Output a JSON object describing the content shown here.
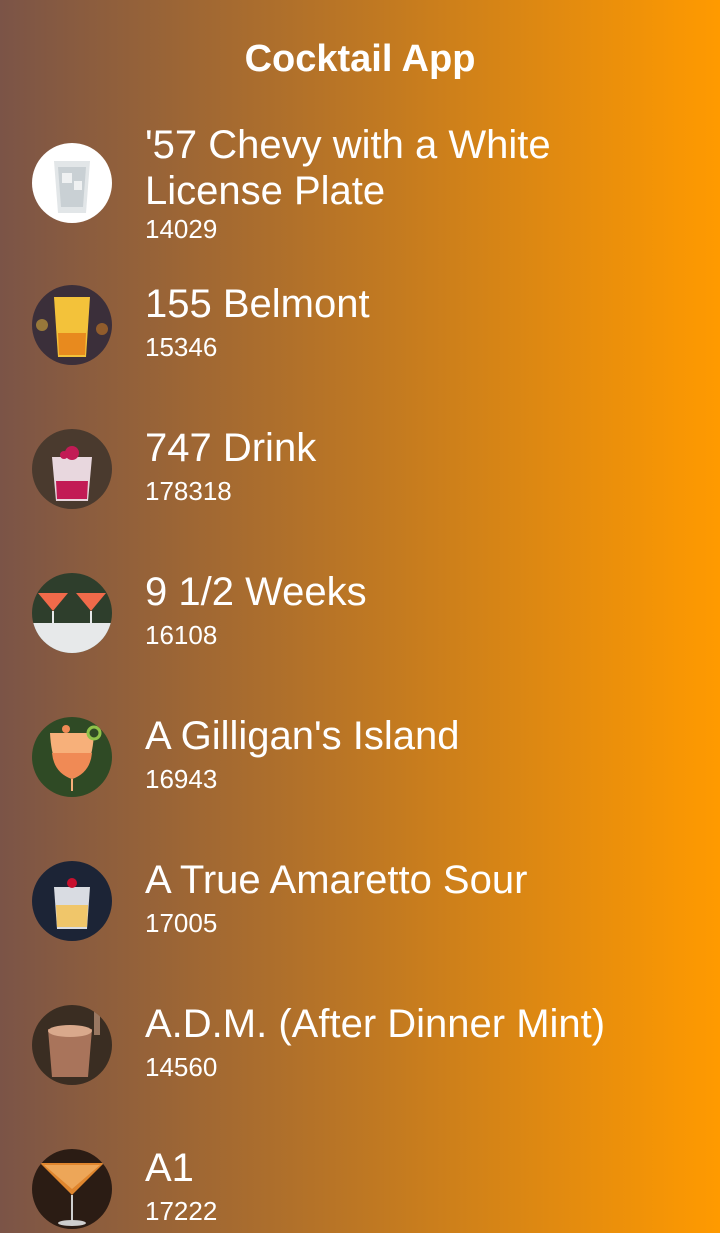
{
  "app": {
    "title": "Cocktail App",
    "background_gradient": {
      "from": "#7b5447",
      "to": "#ff9a00"
    }
  },
  "drinks": [
    {
      "name": "'57 Chevy with a White License Plate",
      "id": "14029",
      "thumb_icon": "ice-glass-photo",
      "colors": [
        "#ffffff",
        "#e2e6e8",
        "#b9c2c6"
      ]
    },
    {
      "name": "155 Belmont",
      "id": "15346",
      "thumb_icon": "yellow-cocktail-photo",
      "colors": [
        "#3b2f3a",
        "#f3c23a",
        "#e88a1e"
      ]
    },
    {
      "name": "747 Drink",
      "id": "178318",
      "thumb_icon": "pink-cocktail-photo",
      "colors": [
        "#4a3a2e",
        "#e8d7de",
        "#c21b55"
      ]
    },
    {
      "name": "9 1/2 Weeks",
      "id": "16108",
      "thumb_icon": "martini-glasses-photo",
      "colors": [
        "#2e3e2c",
        "#f06a4a",
        "#e7e9ea"
      ]
    },
    {
      "name": "A Gilligan's Island",
      "id": "16943",
      "thumb_icon": "orange-cocktail-photo",
      "colors": [
        "#2f4a25",
        "#f7b07a",
        "#f08a55"
      ]
    },
    {
      "name": "A True Amaretto Sour",
      "id": "17005",
      "thumb_icon": "amaretto-sour-photo",
      "colors": [
        "#1c2436",
        "#f0c66a",
        "#d9dce2"
      ]
    },
    {
      "name": "A.D.M. (After Dinner Mint)",
      "id": "14560",
      "thumb_icon": "coffee-cocktail-photo",
      "colors": [
        "#3a2d22",
        "#a9745b",
        "#d9a98c"
      ]
    },
    {
      "name": "A1",
      "id": "17222",
      "thumb_icon": "orange-martini-photo",
      "colors": [
        "#2b1c14",
        "#e0862e",
        "#f2b46b"
      ]
    }
  ]
}
